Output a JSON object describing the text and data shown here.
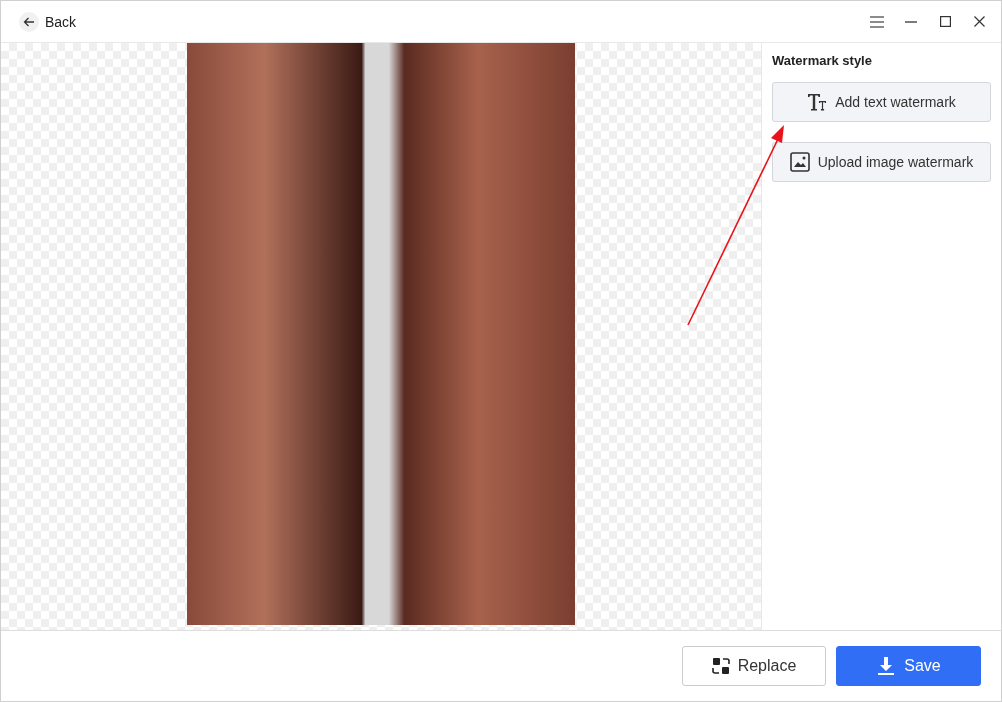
{
  "title_bar": {
    "back_label": "Back"
  },
  "sidebar": {
    "title": "Watermark style",
    "options": [
      {
        "kind": "text",
        "label": "Add text watermark"
      },
      {
        "kind": "image",
        "label": "Upload image watermark"
      }
    ]
  },
  "footer": {
    "buttons": [
      {
        "kind": "replace",
        "label": "Replace"
      },
      {
        "kind": "save",
        "label": "Save"
      }
    ]
  }
}
